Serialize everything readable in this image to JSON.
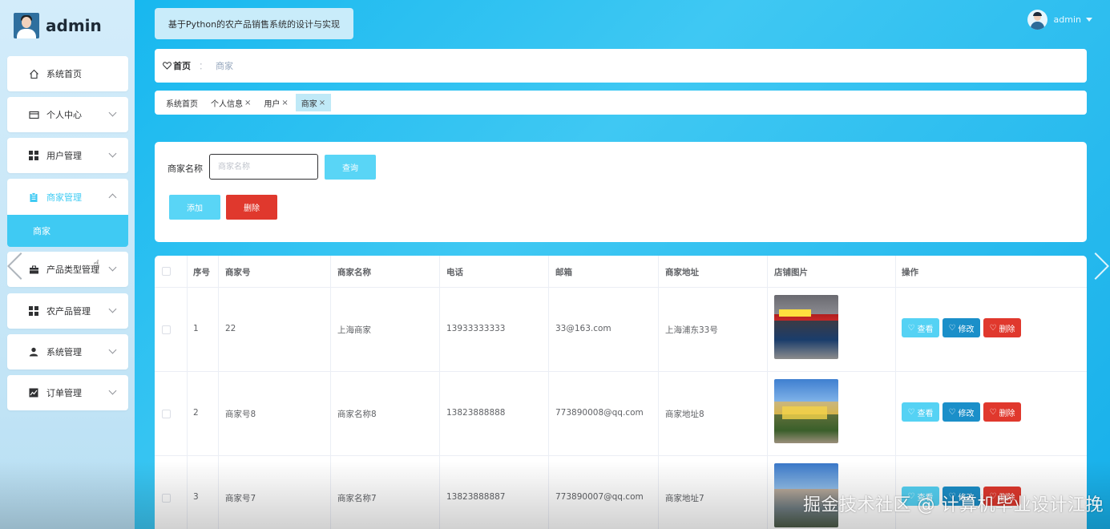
{
  "sidebar": {
    "brand": "admin",
    "items": [
      {
        "label": "系统首页",
        "icon": "home-icon"
      },
      {
        "label": "个人中心",
        "icon": "card-icon"
      },
      {
        "label": "用户管理",
        "icon": "grid-icon"
      },
      {
        "label": "商家管理",
        "icon": "clipboard-icon"
      },
      {
        "label": "产品类型管理",
        "icon": "briefcase-icon"
      },
      {
        "label": "农产品管理",
        "icon": "grid-icon"
      },
      {
        "label": "系统管理",
        "icon": "person-icon"
      },
      {
        "label": "订单管理",
        "icon": "chart-icon"
      }
    ],
    "submenu": {
      "label": "商家"
    }
  },
  "header": {
    "system_title": "基于Python的农产品销售系统的设计与实现",
    "user": "admin"
  },
  "breadcrumb": {
    "home": "首页",
    "separator": "：",
    "current": "商家"
  },
  "tags": [
    {
      "label": "系统首页",
      "closable": false
    },
    {
      "label": "个人信息",
      "closable": true
    },
    {
      "label": "用户",
      "closable": true
    },
    {
      "label": "商家",
      "closable": true
    }
  ],
  "search": {
    "label": "商家名称",
    "placeholder": "商家名称",
    "query_button": "查询",
    "add_button": "添加",
    "delete_button": "删除"
  },
  "table": {
    "columns": [
      "序号",
      "商家号",
      "商家名称",
      "电话",
      "邮箱",
      "商家地址",
      "店铺图片",
      "操作"
    ],
    "rows": [
      {
        "index": "1",
        "merchant_no": "22",
        "name": "上海商家",
        "phone": "13933333333",
        "email": "33@163.com",
        "address": "上海浦东33号"
      },
      {
        "index": "2",
        "merchant_no": "商家号8",
        "name": "商家名称8",
        "phone": "13823888888",
        "email": "773890008@qq.com",
        "address": "商家地址8"
      },
      {
        "index": "3",
        "merchant_no": "商家号7",
        "name": "商家名称7",
        "phone": "13823888887",
        "email": "773890007@qq.com",
        "address": "商家地址7"
      }
    ],
    "actions": {
      "view": "查看",
      "edit": "修改",
      "delete": "删除"
    }
  },
  "watermark": "掘金技术社区 @ 计算机毕业设计江挽",
  "colors": {
    "accent": "#3fcaf3",
    "danger": "#e0382d",
    "edit": "#1b8fc9"
  }
}
